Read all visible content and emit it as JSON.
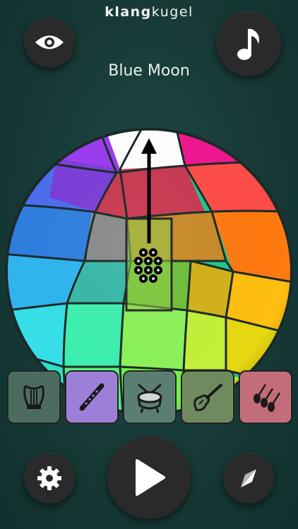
{
  "app": {
    "title_part1": "klang",
    "title_part2": "kugel"
  },
  "song": {
    "title": "Blue Moon"
  },
  "top_buttons": {
    "left_icon": "eye-icon",
    "right_icon": "music-note-icon"
  },
  "instruments": [
    {
      "name": "harp",
      "icon": "harp-icon",
      "color": "#4b6b5f"
    },
    {
      "name": "flute",
      "icon": "flute-icon",
      "color": "#9d7fd8"
    },
    {
      "name": "drum",
      "icon": "drum-icon",
      "color": "#5b7e72"
    },
    {
      "name": "bass-guitar",
      "icon": "bass-guitar-icon",
      "color": "#6f8a5f"
    },
    {
      "name": "strings",
      "icon": "strings-icon",
      "color": "#c46d7a"
    }
  ],
  "bottom_buttons": {
    "left_icon": "gear-icon",
    "center_icon": "play-icon",
    "right_icon": "compass-icon"
  }
}
